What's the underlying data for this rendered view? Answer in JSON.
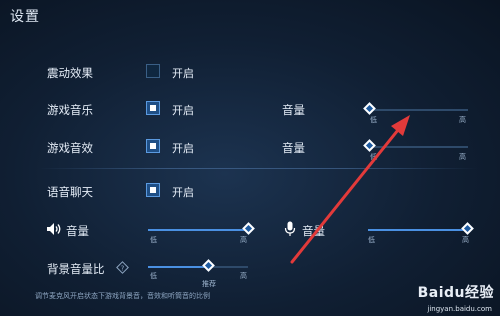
{
  "title": "设置",
  "rows": [
    {
      "label": "震动效果",
      "state": "开启",
      "checked": false
    },
    {
      "label": "游戏音乐",
      "state": "开启",
      "checked": true
    },
    {
      "label": "游戏音效",
      "state": "开启",
      "checked": true
    },
    {
      "label": "语音聊天",
      "state": "开启",
      "checked": true
    }
  ],
  "music_volume": {
    "label": "音量",
    "low": "低",
    "high": "高",
    "level": 0
  },
  "sfx_volume": {
    "label": "音量",
    "low": "低",
    "high": "高",
    "level": 0
  },
  "speaker_volume": {
    "label": "音量",
    "low": "低",
    "high": "高",
    "level": 1
  },
  "mic_volume": {
    "label": "音量",
    "low": "低",
    "high": "高",
    "level": 1
  },
  "bg_ratio": {
    "label": "背景音量比",
    "low": "低",
    "high": "高",
    "recommend": "推荐",
    "level": 0.6
  },
  "note": "调节麦克风开启状态下游戏背景音，音效和听筒音的比例",
  "watermark": {
    "brand": "Baidu经验",
    "url": "jingyan.baidu.com"
  },
  "colors": {
    "accent": "#4a90e2",
    "arrow": "#e23a3a"
  }
}
